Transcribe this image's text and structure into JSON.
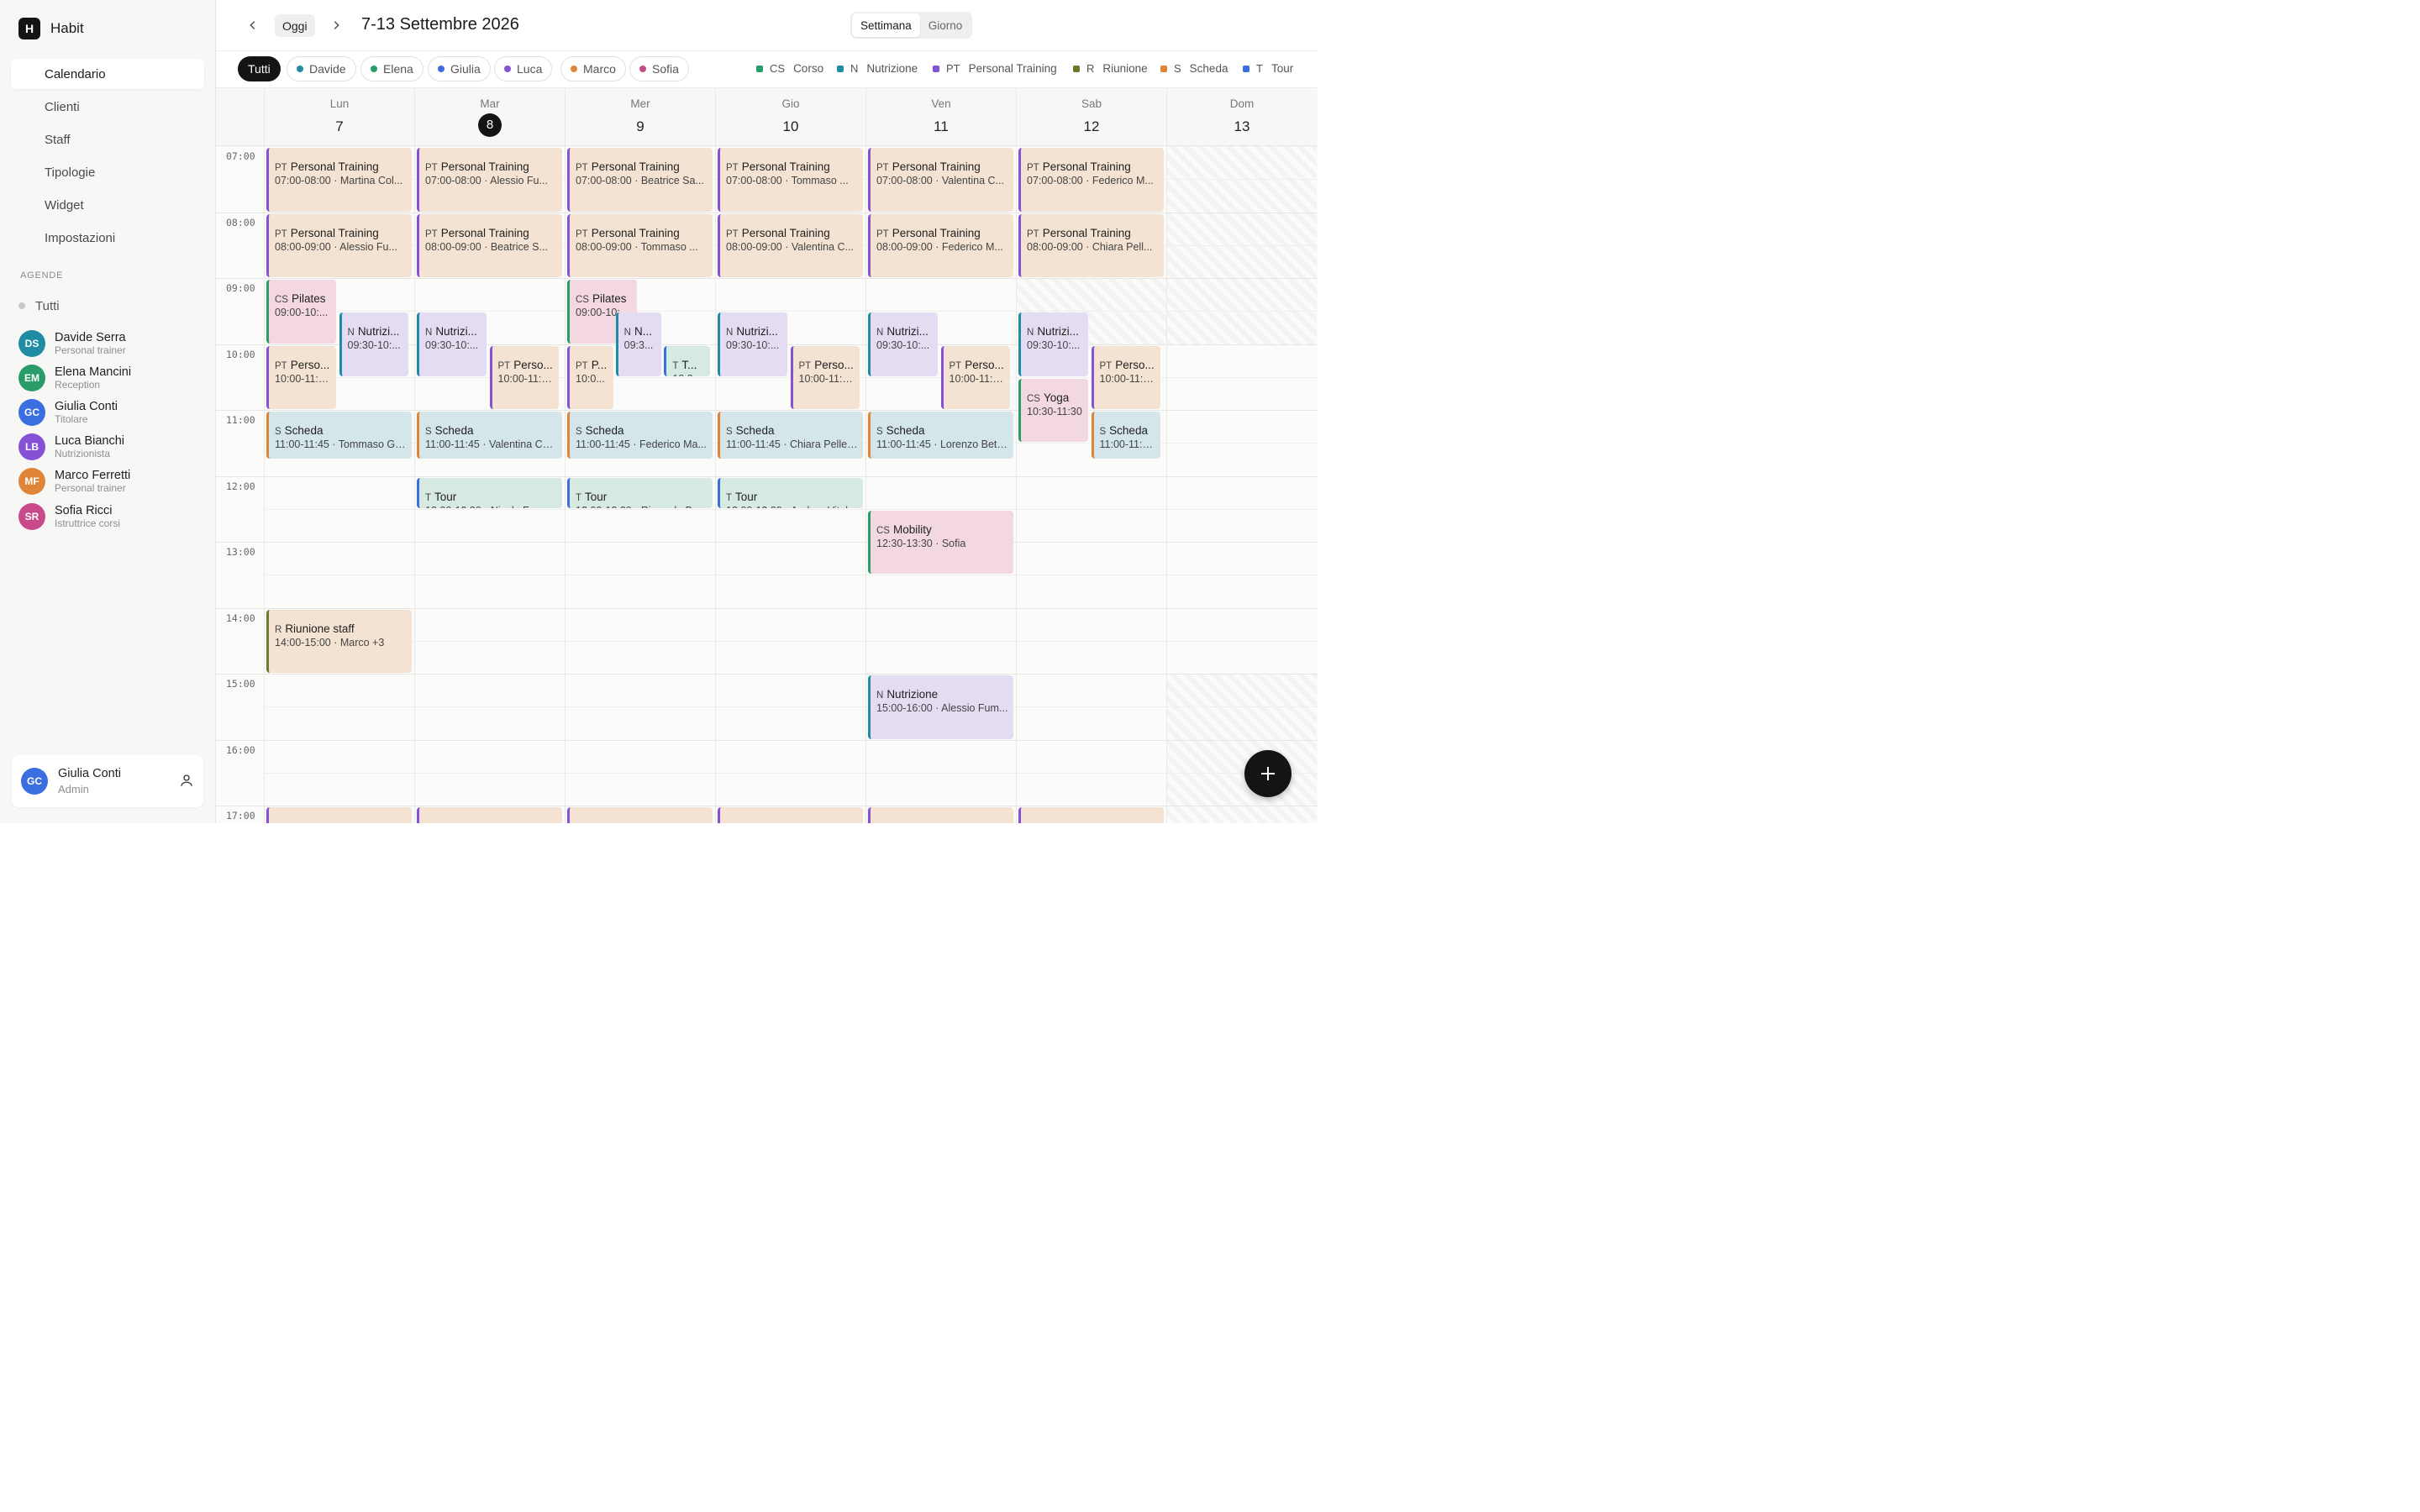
{
  "app": {
    "logo": "H",
    "name": "Habit"
  },
  "nav": [
    {
      "label": "Calendario",
      "icon": "calendar-icon",
      "active": true
    },
    {
      "label": "Clienti",
      "icon": "users-icon"
    },
    {
      "label": "Staff",
      "icon": "briefcase-icon"
    },
    {
      "label": "Tipologie",
      "icon": "tag-icon"
    },
    {
      "label": "Widget",
      "icon": "grid-icon"
    },
    {
      "label": "Impostazioni",
      "icon": "gear-icon"
    }
  ],
  "agende": {
    "title": "AGENDE",
    "all_label": "Tutti",
    "staff": [
      {
        "initials": "DS",
        "name": "Davide Serra",
        "role": "Personal trainer",
        "color": "#1f8ca3"
      },
      {
        "initials": "EM",
        "name": "Elena Mancini",
        "role": "Reception",
        "color": "#2a9c69"
      },
      {
        "initials": "GC",
        "name": "Giulia Conti",
        "role": "Titolare",
        "color": "#3b6ee0"
      },
      {
        "initials": "LB",
        "name": "Luca Bianchi",
        "role": "Nutrizionista",
        "color": "#8552d6"
      },
      {
        "initials": "MF",
        "name": "Marco Ferretti",
        "role": "Personal trainer",
        "color": "#e08537"
      },
      {
        "initials": "SR",
        "name": "Sofia Ricci",
        "role": "Istruttrice corsi",
        "color": "#c94a8a"
      }
    ]
  },
  "user": {
    "initials": "GC",
    "name": "Giulia Conti",
    "role": "Admin",
    "color": "#3b6ee0"
  },
  "header": {
    "today": "Oggi",
    "range": "7-13 Settembre 2026",
    "views": [
      "Settimana",
      "Giorno"
    ],
    "active_view": "Settimana"
  },
  "filters": [
    {
      "label": "Tutti",
      "active": true
    },
    {
      "label": "Davide",
      "color": "#1f8ca3"
    },
    {
      "label": "Elena",
      "color": "#2a9c69"
    },
    {
      "label": "Giulia",
      "color": "#3b6ee0"
    },
    {
      "label": "Luca",
      "color": "#8552d6"
    },
    {
      "label": "Marco",
      "color": "#e08537"
    },
    {
      "label": "Sofia",
      "color": "#c94a8a"
    }
  ],
  "legend": [
    {
      "code": "CS",
      "label": "Corso",
      "color": "#2a9c69"
    },
    {
      "code": "N",
      "label": "Nutrizione",
      "color": "#1f8ca3"
    },
    {
      "code": "PT",
      "label": "Personal Training",
      "color": "#8552d6"
    },
    {
      "code": "R",
      "label": "Riunione",
      "color": "#6c7a2e"
    },
    {
      "code": "S",
      "label": "Scheda",
      "color": "#e08537"
    },
    {
      "code": "T",
      "label": "Tour",
      "color": "#3b6ee0"
    }
  ],
  "days": [
    {
      "name": "Lun",
      "num": "7"
    },
    {
      "name": "Mar",
      "num": "8",
      "today": true
    },
    {
      "name": "Mer",
      "num": "9"
    },
    {
      "name": "Gio",
      "num": "10"
    },
    {
      "name": "Ven",
      "num": "11"
    },
    {
      "name": "Sab",
      "num": "12"
    },
    {
      "name": "Dom",
      "num": "13"
    }
  ],
  "hours": [
    "07:00",
    "08:00",
    "09:00",
    "10:00",
    "11:00",
    "12:00",
    "13:00",
    "14:00",
    "15:00",
    "16:00",
    "17:00"
  ],
  "events": [
    {
      "day": 0,
      "start": 7,
      "end": 8,
      "type": "pt",
      "code": "PT",
      "title": "Personal Training",
      "sub": "07:00-08:00 · Martina Col..."
    },
    {
      "day": 1,
      "start": 7,
      "end": 8,
      "type": "pt",
      "code": "PT",
      "title": "Personal Training",
      "sub": "07:00-08:00 · Alessio Fu..."
    },
    {
      "day": 2,
      "start": 7,
      "end": 8,
      "type": "pt",
      "code": "PT",
      "title": "Personal Training",
      "sub": "07:00-08:00 · Beatrice Sa..."
    },
    {
      "day": 3,
      "start": 7,
      "end": 8,
      "type": "pt",
      "code": "PT",
      "title": "Personal Training",
      "sub": "07:00-08:00 · Tommaso ..."
    },
    {
      "day": 4,
      "start": 7,
      "end": 8,
      "type": "pt",
      "code": "PT",
      "title": "Personal Training",
      "sub": "07:00-08:00 · Valentina C..."
    },
    {
      "day": 5,
      "start": 7,
      "end": 8,
      "type": "pt",
      "code": "PT",
      "title": "Personal Training",
      "sub": "07:00-08:00 · Federico M..."
    },
    {
      "day": 0,
      "start": 8,
      "end": 9,
      "type": "pt",
      "code": "PT",
      "title": "Personal Training",
      "sub": "08:00-09:00 · Alessio Fu..."
    },
    {
      "day": 1,
      "start": 8,
      "end": 9,
      "type": "pt",
      "code": "PT",
      "title": "Personal Training",
      "sub": "08:00-09:00 · Beatrice S..."
    },
    {
      "day": 2,
      "start": 8,
      "end": 9,
      "type": "pt",
      "code": "PT",
      "title": "Personal Training",
      "sub": "08:00-09:00 · Tommaso ..."
    },
    {
      "day": 3,
      "start": 8,
      "end": 9,
      "type": "pt",
      "code": "PT",
      "title": "Personal Training",
      "sub": "08:00-09:00 · Valentina C..."
    },
    {
      "day": 4,
      "start": 8,
      "end": 9,
      "type": "pt",
      "code": "PT",
      "title": "Personal Training",
      "sub": "08:00-09:00 · Federico M..."
    },
    {
      "day": 5,
      "start": 8,
      "end": 9,
      "type": "pt",
      "code": "PT",
      "title": "Personal Training",
      "sub": "08:00-09:00 · Chiara Pell..."
    },
    {
      "day": 0,
      "start": 9,
      "end": 10,
      "type": "cs",
      "code": "CS",
      "title": "Pilates",
      "sub": "09:00-10:...",
      "lane": 0,
      "lanes": 2
    },
    {
      "day": 0,
      "start": 9.5,
      "end": 10.5,
      "type": "n",
      "code": "N",
      "title": "Nutrizi...",
      "sub": "09:30-10:...",
      "lane": 1,
      "lanes": 2
    },
    {
      "day": 0,
      "start": 10,
      "end": 11,
      "type": "pt",
      "code": "PT",
      "title": "Perso...",
      "sub": "10:00-11:0...",
      "lane": 0,
      "lanes": 2
    },
    {
      "day": 0,
      "start": 11,
      "end": 11.75,
      "type": "s2",
      "code": "S",
      "title": "Scheda",
      "sub": "11:00-11:45 · Tommaso Gr..."
    },
    {
      "day": 0,
      "start": 14,
      "end": 15,
      "type": "r",
      "code": "R",
      "title": "Riunione staff",
      "sub": "14:00-15:00 · Marco +3"
    },
    {
      "day": 1,
      "start": 9.5,
      "end": 10.5,
      "type": "n",
      "code": "N",
      "title": "Nutrizi...",
      "sub": "09:30-10:...",
      "lane": 0,
      "lanes": 2
    },
    {
      "day": 1,
      "start": 10,
      "end": 11,
      "type": "pt",
      "code": "PT",
      "title": "Perso...",
      "sub": "10:00-11:0...",
      "lane": 1,
      "lanes": 2
    },
    {
      "day": 1,
      "start": 11,
      "end": 11.75,
      "type": "s2",
      "code": "S",
      "title": "Scheda",
      "sub": "11:00-11:45 · Valentina Ca..."
    },
    {
      "day": 1,
      "start": 12,
      "end": 12.5,
      "type": "tr",
      "code": "T",
      "title": "Tour",
      "sub": "12:00-12:30 · Nicola Ferra..."
    },
    {
      "day": 2,
      "start": 9,
      "end": 10,
      "type": "cs",
      "code": "CS",
      "title": "Pilates",
      "sub": "09:00-10:...",
      "lane": 0,
      "lanes": 2
    },
    {
      "day": 2,
      "start": 9.5,
      "end": 10.5,
      "type": "n",
      "code": "N",
      "title": "N...",
      "sub": "09:3...",
      "lane": 1,
      "lanes": 3
    },
    {
      "day": 2,
      "start": 10,
      "end": 11,
      "type": "pt",
      "code": "PT",
      "title": "P...",
      "sub": "10:0...",
      "lane": 0,
      "lanes": 3
    },
    {
      "day": 2,
      "start": 10,
      "end": 10.5,
      "type": "tr",
      "code": "T",
      "title": "T...",
      "sub": "10:0...",
      "lane": 2,
      "lanes": 3
    },
    {
      "day": 2,
      "start": 11,
      "end": 11.75,
      "type": "s2",
      "code": "S",
      "title": "Scheda",
      "sub": "11:00-11:45 · Federico Ma..."
    },
    {
      "day": 2,
      "start": 12,
      "end": 12.5,
      "type": "tr",
      "code": "T",
      "title": "Tour",
      "sub": "12:00-12:30 · Riccardo Br..."
    },
    {
      "day": 3,
      "start": 9.5,
      "end": 10.5,
      "type": "n",
      "code": "N",
      "title": "Nutrizi...",
      "sub": "09:30-10:...",
      "lane": 0,
      "lanes": 2
    },
    {
      "day": 3,
      "start": 10,
      "end": 11,
      "type": "pt",
      "code": "PT",
      "title": "Perso...",
      "sub": "10:00-11:0...",
      "lane": 1,
      "lanes": 2
    },
    {
      "day": 3,
      "start": 11,
      "end": 11.75,
      "type": "s2",
      "code": "S",
      "title": "Scheda",
      "sub": "11:00-11:45 · Chiara Pelleg..."
    },
    {
      "day": 3,
      "start": 12,
      "end": 12.5,
      "type": "tr",
      "code": "T",
      "title": "Tour",
      "sub": "12:00-12:30 · Andrea Vital..."
    },
    {
      "day": 4,
      "start": 9.5,
      "end": 10.5,
      "type": "n",
      "code": "N",
      "title": "Nutrizi...",
      "sub": "09:30-10:...",
      "lane": 0,
      "lanes": 2
    },
    {
      "day": 4,
      "start": 10,
      "end": 11,
      "type": "pt",
      "code": "PT",
      "title": "Perso...",
      "sub": "10:00-11:0...",
      "lane": 1,
      "lanes": 2
    },
    {
      "day": 4,
      "start": 11,
      "end": 11.75,
      "type": "s2",
      "code": "S",
      "title": "Scheda",
      "sub": "11:00-11:45 · Lorenzo Betti..."
    },
    {
      "day": 4,
      "start": 12.5,
      "end": 13.5,
      "type": "cs",
      "code": "CS",
      "title": "Mobility",
      "sub": "12:30-13:30 · Sofia"
    },
    {
      "day": 4,
      "start": 15,
      "end": 16,
      "type": "n",
      "code": "N",
      "title": "Nutrizione",
      "sub": "15:00-16:00 · Alessio Fum..."
    },
    {
      "day": 5,
      "start": 9.5,
      "end": 10.5,
      "type": "n",
      "code": "N",
      "title": "Nutrizi...",
      "sub": "09:30-10:...",
      "lane": 0,
      "lanes": 2
    },
    {
      "day": 5,
      "start": 10,
      "end": 11,
      "type": "pt",
      "code": "PT",
      "title": "Perso...",
      "sub": "10:00-11:0...",
      "lane": 1,
      "lanes": 2
    },
    {
      "day": 5,
      "start": 10.5,
      "end": 11.5,
      "type": "cs",
      "code": "CS",
      "title": "Yoga",
      "sub": "10:30-11:30",
      "lane": 0,
      "lanes": 2
    },
    {
      "day": 5,
      "start": 11,
      "end": 11.75,
      "type": "s2",
      "code": "S",
      "title": "Scheda",
      "sub": "11:00-11:4...",
      "lane": 1,
      "lanes": 2
    }
  ]
}
